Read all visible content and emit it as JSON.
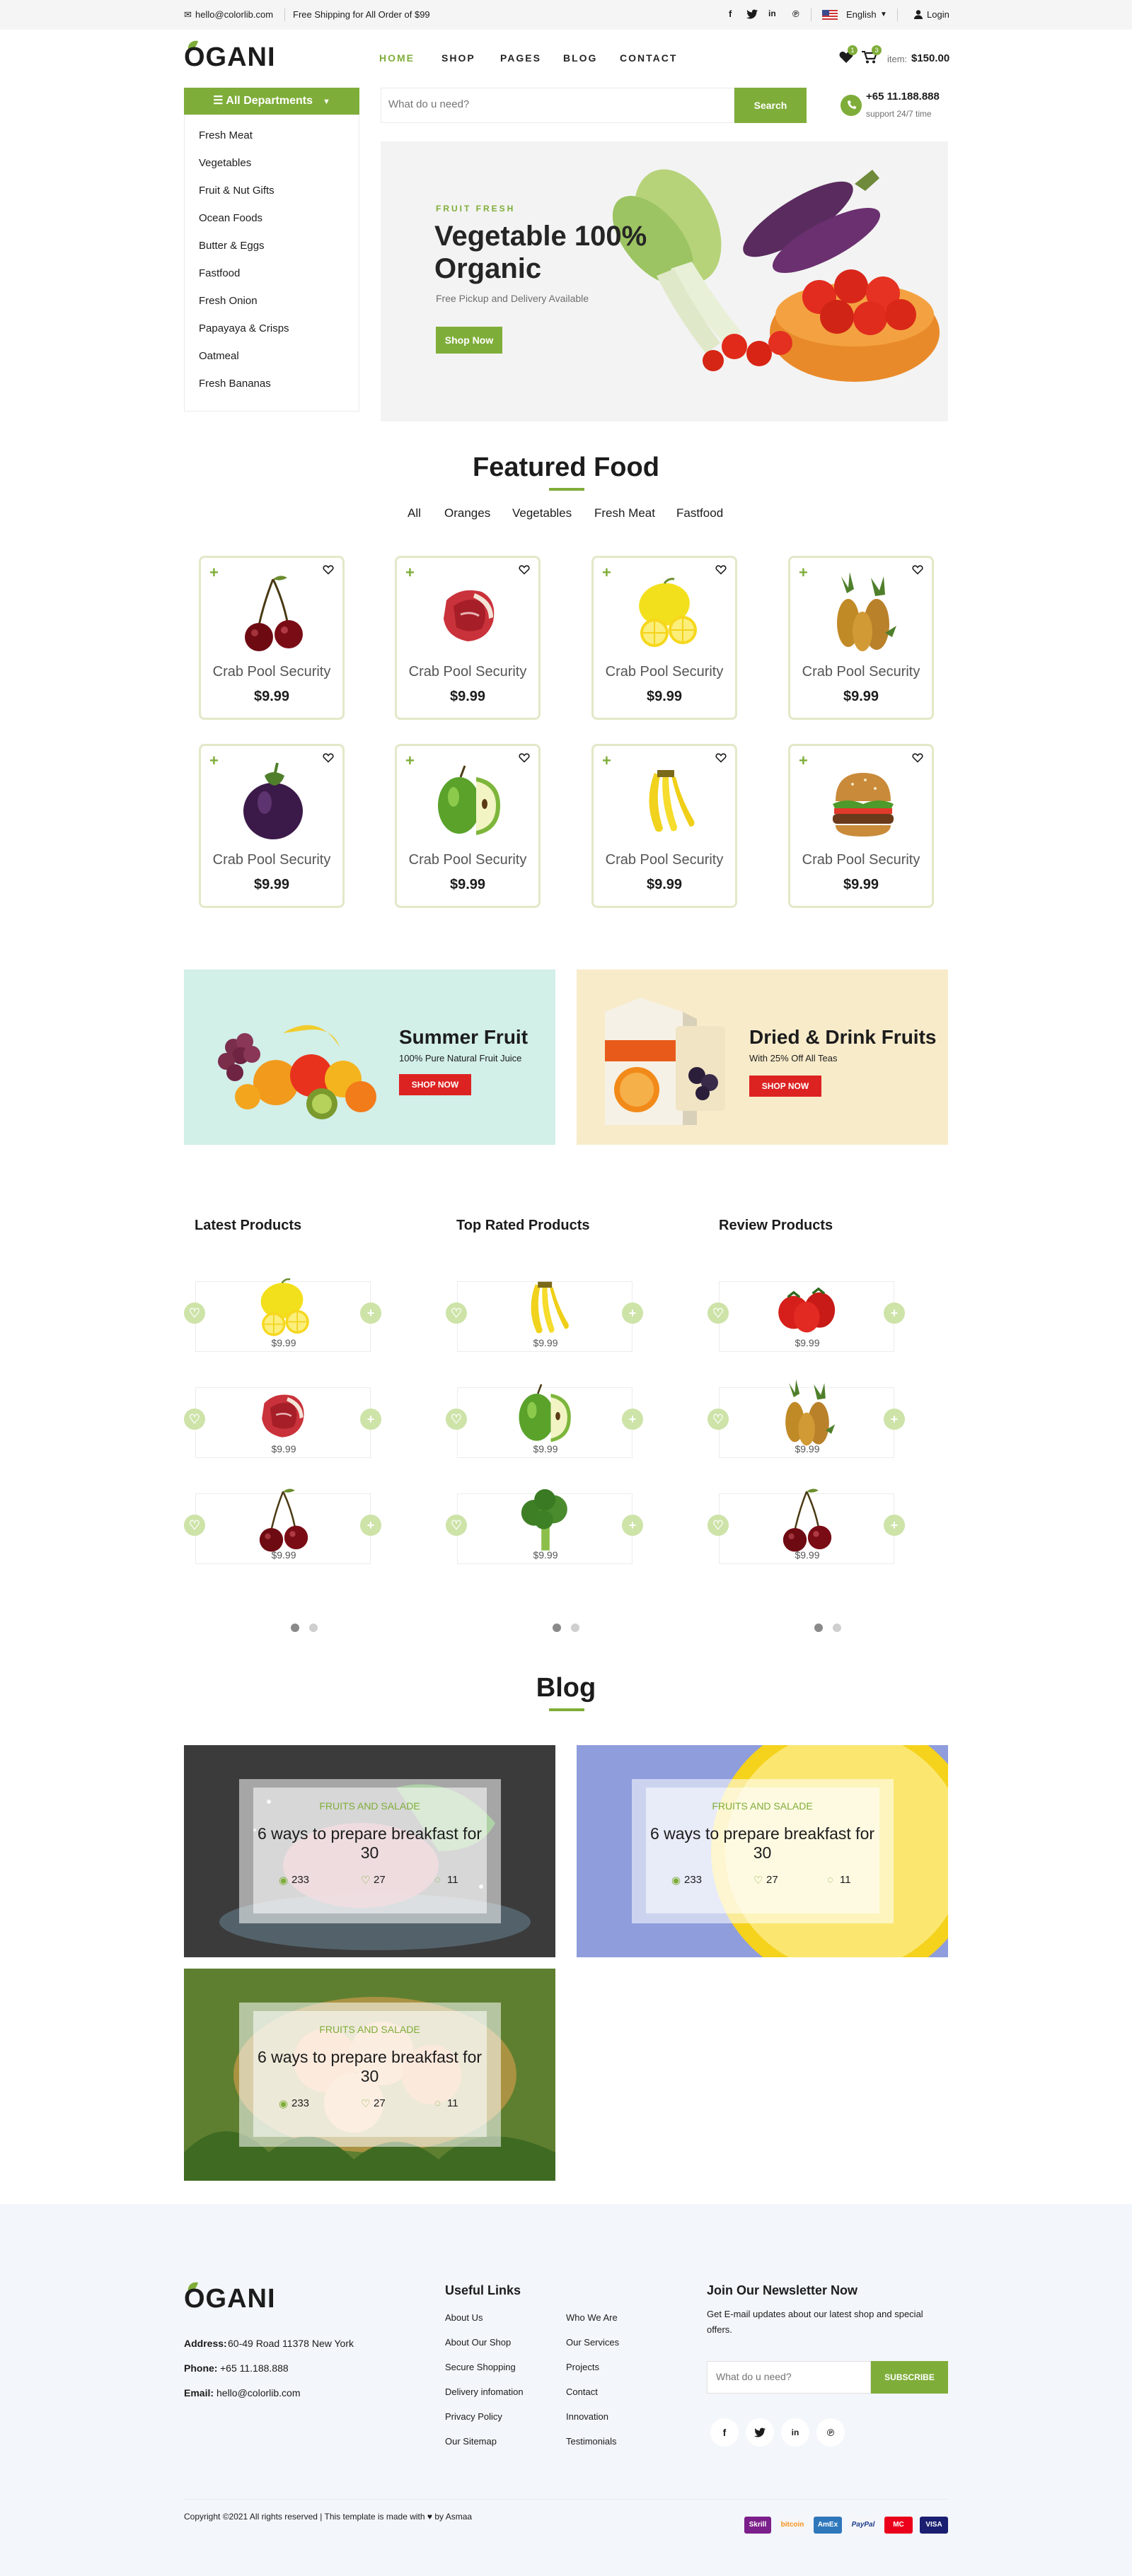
{
  "topbar": {
    "email": "hello@colorlib.com",
    "shipping": "Free Shipping for All Order of $99",
    "language": "English",
    "login": "Login",
    "social_icons": [
      "facebook-icon",
      "twitter-icon",
      "linkedin-icon",
      "pinterest-icon"
    ]
  },
  "header": {
    "logo": "OGANI",
    "nav": [
      "HOME",
      "SHOP",
      "PAGES",
      "BLOG",
      "CONTACT"
    ],
    "wishlist_count": "1",
    "cart_count": "3",
    "item_label": "item:",
    "item_total": "$150.00"
  },
  "departments": {
    "title": "All Departments",
    "items": [
      "Fresh Meat",
      "Vegetables",
      "Fruit & Nut Gifts",
      "Ocean Foods",
      "Butter & Eggs",
      "Fastfood",
      "Fresh Onion",
      "Papayaya & Crisps",
      "Oatmeal",
      "Fresh Bananas"
    ]
  },
  "search": {
    "placeholder": "What do u need?",
    "button": "Search",
    "phone": "+65 11.188.888",
    "support": "support 24/7 time"
  },
  "hero": {
    "kicker": "FRUIT FRESH",
    "title_line1": "Vegetable 100%",
    "title_line2": "Organic",
    "subtitle": "Free Pickup and Delivery Available",
    "cta": "Shop Now"
  },
  "featured": {
    "title": "Featured Food",
    "filters": [
      "All",
      "Oranges",
      "Vegetables",
      "Fresh Meat",
      "Fastfood"
    ],
    "products": [
      {
        "name": "Crab Pool Security",
        "price": "$9.99",
        "image": "cherries"
      },
      {
        "name": "Crab Pool Security",
        "price": "$9.99",
        "image": "steak"
      },
      {
        "name": "Crab Pool Security",
        "price": "$9.99",
        "image": "lemon"
      },
      {
        "name": "Crab Pool Security",
        "price": "$9.99",
        "image": "pineapple"
      },
      {
        "name": "Crab Pool Security",
        "price": "$9.99",
        "image": "eggplant"
      },
      {
        "name": "Crab Pool Security",
        "price": "$9.99",
        "image": "apple"
      },
      {
        "name": "Crab Pool Security",
        "price": "$9.99",
        "image": "banana"
      },
      {
        "name": "Crab Pool Security",
        "price": "$9.99",
        "image": "burger"
      }
    ]
  },
  "banners": [
    {
      "title": "Summer Fruit",
      "subtitle": "100% Pure Natural Fruit Juice",
      "cta": "SHOP NOW",
      "bg": "#d2efe8"
    },
    {
      "title": "Dried & Drink Fruits",
      "subtitle": "With 25% Off All Teas",
      "cta": "SHOP NOW",
      "bg": "#f8ebca"
    }
  ],
  "lists": [
    {
      "title": "Latest Products",
      "items": [
        {
          "price": "$9.99",
          "image": "lemon"
        },
        {
          "price": "$9.99",
          "image": "steak"
        },
        {
          "price": "$9.99",
          "image": "cherries"
        }
      ]
    },
    {
      "title": "Top Rated Products",
      "items": [
        {
          "price": "$9.99",
          "image": "banana"
        },
        {
          "price": "$9.99",
          "image": "apple"
        },
        {
          "price": "$9.99",
          "image": "broccoli"
        }
      ]
    },
    {
      "title": "Review Products",
      "items": [
        {
          "price": "$9.99",
          "image": "tomatoes"
        },
        {
          "price": "$9.99",
          "image": "pineapple"
        },
        {
          "price": "$9.99",
          "image": "cherries"
        }
      ]
    }
  ],
  "blog": {
    "title": "Blog",
    "posts": [
      {
        "category": "FRUITS AND SALADE",
        "title": "6 ways to prepare breakfast for 30",
        "views": "233",
        "likes": "27",
        "comments": "11"
      },
      {
        "category": "FRUITS AND SALADE",
        "title": "6 ways to prepare breakfast for 30",
        "views": "233",
        "likes": "27",
        "comments": "11"
      },
      {
        "category": "FRUITS AND SALADE",
        "title": "6 ways to prepare breakfast for 30",
        "views": "233",
        "likes": "27",
        "comments": "11"
      }
    ]
  },
  "footer": {
    "logo": "OGANI",
    "address_label": "Address:",
    "address": "60-49 Road 11378 New York",
    "phone_label": "Phone:",
    "phone": "+65 11.188.888",
    "email_label": "Email:",
    "email": "hello@colorlib.com",
    "links_title": "Useful Links",
    "links_col1": [
      "About Us",
      "About Our Shop",
      "Secure Shopping",
      "Delivery infomation",
      "Privacy Policy",
      "Our Sitemap"
    ],
    "links_col2": [
      "Who We Are",
      "Our Services",
      "Projects",
      "Contact",
      "Innovation",
      "Testimonials"
    ],
    "newsletter_title": "Join Our Newsletter Now",
    "newsletter_text": "Get E-mail updates about our latest shop and special offers.",
    "newsletter_placeholder": "What do u need?",
    "subscribe": "SUBSCRIBE",
    "copyright_pre": "Copyright ©2021 All rights reserved | This template is made with",
    "copyright_post": "by Asmaa",
    "payments": [
      "Skrill",
      "bitcoin",
      "AmEx",
      "PayPal",
      "MC",
      "VISA"
    ]
  },
  "colors": {
    "accent": "#7fad39",
    "sale": "#dd2222"
  }
}
